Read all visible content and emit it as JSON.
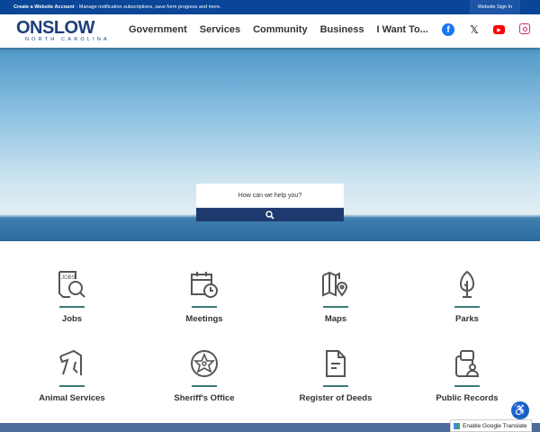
{
  "topbar": {
    "account_link": "Create a Website Account",
    "account_text": " - Manage notification subscriptions, save form progress and more.",
    "sign_in": "Website Sign In"
  },
  "logo": {
    "main": "ONSLOW",
    "sub": "NORTH CAROLINA"
  },
  "nav": [
    "Government",
    "Services",
    "Community",
    "Business",
    "I Want To..."
  ],
  "social": [
    {
      "icon": "facebook-icon",
      "color": "#1877f2"
    },
    {
      "icon": "x-icon",
      "color": "#000000"
    },
    {
      "icon": "youtube-icon",
      "color": "#ff0000"
    },
    {
      "icon": "instagram-icon",
      "color": "#d62976"
    }
  ],
  "search": {
    "placeholder": "How can we help you?"
  },
  "tiles": [
    {
      "label": "Jobs",
      "icon": "jobs-search-icon"
    },
    {
      "label": "Meetings",
      "icon": "calendar-clock-icon"
    },
    {
      "label": "Maps",
      "icon": "map-pin-icon"
    },
    {
      "label": "Parks",
      "icon": "tree-icon"
    },
    {
      "label": "Animal Services",
      "icon": "dog-icon"
    },
    {
      "label": "Sheriff's Office",
      "icon": "sheriff-badge-icon"
    },
    {
      "label": "Register of Deeds",
      "icon": "document-icon"
    },
    {
      "label": "Public Records",
      "icon": "records-person-icon"
    }
  ],
  "translate": {
    "label": "Enable Google Translate"
  }
}
